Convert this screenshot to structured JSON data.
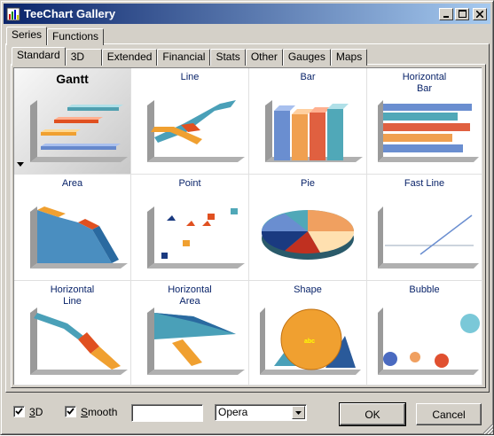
{
  "window": {
    "title": "TeeChart Gallery"
  },
  "outer_tabs": [
    {
      "label": "Series",
      "selected": true
    },
    {
      "label": "Functions",
      "selected": false
    }
  ],
  "inner_tabs": [
    {
      "label": "Standard",
      "selected": true
    },
    {
      "label": "3D",
      "selected": false
    },
    {
      "label": "Extended",
      "selected": false
    },
    {
      "label": "Financial",
      "selected": false
    },
    {
      "label": "Stats",
      "selected": false
    },
    {
      "label": "Other",
      "selected": false
    },
    {
      "label": "Gauges",
      "selected": false
    },
    {
      "label": "Maps",
      "selected": false
    }
  ],
  "gallery": [
    {
      "name": "Gantt",
      "selected": true
    },
    {
      "name": "Line",
      "selected": false
    },
    {
      "name": "Bar",
      "selected": false
    },
    {
      "name": "Horizontal\nBar",
      "selected": false
    },
    {
      "name": "Area",
      "selected": false
    },
    {
      "name": "Point",
      "selected": false
    },
    {
      "name": "Pie",
      "selected": false
    },
    {
      "name": "Fast Line",
      "selected": false
    },
    {
      "name": "Horizontal\nLine",
      "selected": false
    },
    {
      "name": "Horizontal\nArea",
      "selected": false
    },
    {
      "name": "Shape",
      "selected": false
    },
    {
      "name": "Bubble",
      "selected": false
    }
  ],
  "shape_text": "abc",
  "options": {
    "check_3d": {
      "label": "3D",
      "checked": true
    },
    "check_smooth": {
      "label": "Smooth",
      "checked": true
    },
    "edit_value": "",
    "theme": "Opera"
  },
  "buttons": {
    "ok": "OK",
    "cancel": "Cancel"
  },
  "colors": {
    "title_start": "#0a246a",
    "title_end": "#a6caf0",
    "face": "#d4d0c8"
  }
}
